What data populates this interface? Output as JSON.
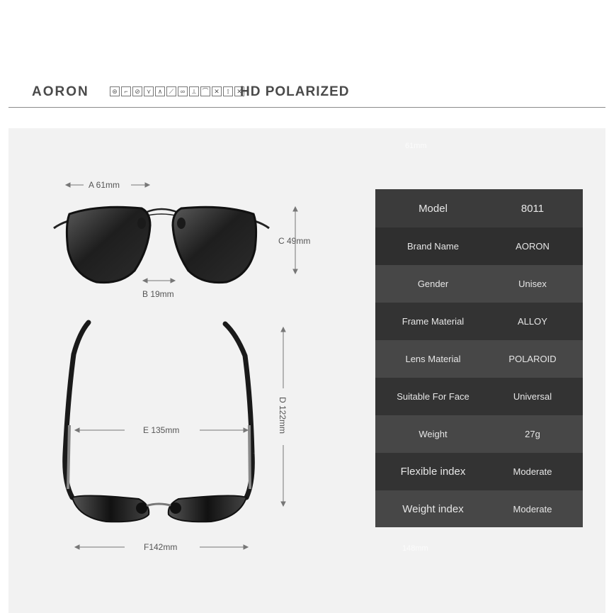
{
  "header": {
    "brand": "AORON",
    "tagline": "HD POLARIZED",
    "activity_icons": [
      "steering-wheel",
      "fishing",
      "cycling",
      "running",
      "hiking",
      "skiing",
      "motorcycling",
      "climbing",
      "golf",
      "skating",
      "fishing-2",
      "hunting"
    ]
  },
  "ghost": {
    "top": "61mm",
    "bottom": "148mm"
  },
  "dimensions": {
    "a": "A 61mm",
    "b": "B 19mm",
    "c": "C 49mm",
    "d": "D 122mm",
    "e": "E 135mm",
    "f": "F142mm"
  },
  "specs": [
    {
      "label": "Model",
      "value": "8011"
    },
    {
      "label": "Brand Name",
      "value": "AORON"
    },
    {
      "label": "Gender",
      "value": "Unisex"
    },
    {
      "label": "Frame Material",
      "value": "ALLOY"
    },
    {
      "label": "Lens Material",
      "value": "POLAROID"
    },
    {
      "label": "Suitable For Face",
      "value": "Universal"
    },
    {
      "label": "Weight",
      "value": "27g"
    },
    {
      "label": "Flexible index",
      "value": "Moderate"
    },
    {
      "label": "Weight index",
      "value": "Moderate"
    }
  ],
  "colors": {
    "row_dark": "#3b3b3b",
    "row_light": "#4d4d4d",
    "panel": "#f2f2f2"
  }
}
